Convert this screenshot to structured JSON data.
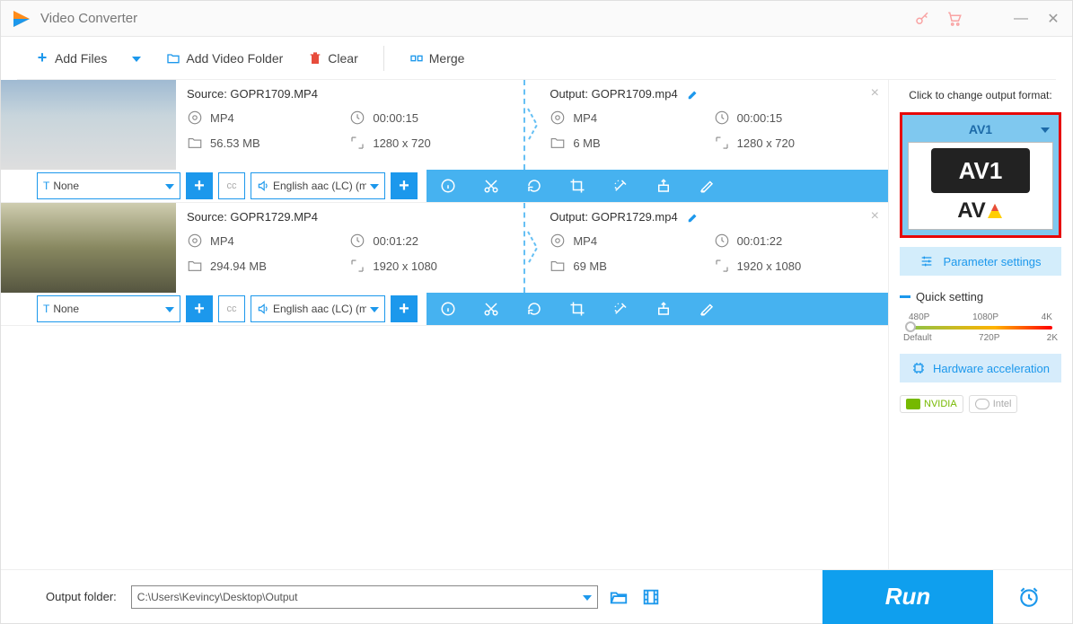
{
  "app": {
    "title": "Video Converter"
  },
  "toolbar": {
    "add_files": "Add Files",
    "add_folder": "Add Video Folder",
    "clear": "Clear",
    "merge": "Merge"
  },
  "files": [
    {
      "source_label": "Source: GOPR1709.MP4",
      "output_label": "Output: GOPR1709.mp4",
      "src_format": "MP4",
      "src_duration": "00:00:15",
      "src_size": "56.53 MB",
      "src_resolution": "1280 x 720",
      "out_format": "MP4",
      "out_duration": "00:00:15",
      "out_size": "6 MB",
      "out_resolution": "1280 x 720",
      "subtitle_sel": "None",
      "audio_sel": "English aac (LC) (mp"
    },
    {
      "source_label": "Source: GOPR1729.MP4",
      "output_label": "Output: GOPR1729.mp4",
      "src_format": "MP4",
      "src_duration": "00:01:22",
      "src_size": "294.94 MB",
      "src_resolution": "1920 x 1080",
      "out_format": "MP4",
      "out_duration": "00:01:22",
      "out_size": "69 MB",
      "out_resolution": "1920 x 1080",
      "subtitle_sel": "None",
      "audio_sel": "English aac (LC) (mp"
    }
  ],
  "side": {
    "change_format_hint": "Click to change output format:",
    "format_name": "AV1",
    "param_settings": "Parameter settings",
    "quick_setting": "Quick setting",
    "q_480": "480P",
    "q_1080": "1080P",
    "q_4k": "4K",
    "q_default": "Default",
    "q_720": "720P",
    "q_2k": "2K",
    "hw_accel": "Hardware acceleration",
    "nvidia": "NVIDIA",
    "intel": "Intel"
  },
  "bottom": {
    "output_folder_label": "Output folder:",
    "output_path": "C:\\Users\\Kevincy\\Desktop\\Output",
    "run": "Run"
  }
}
